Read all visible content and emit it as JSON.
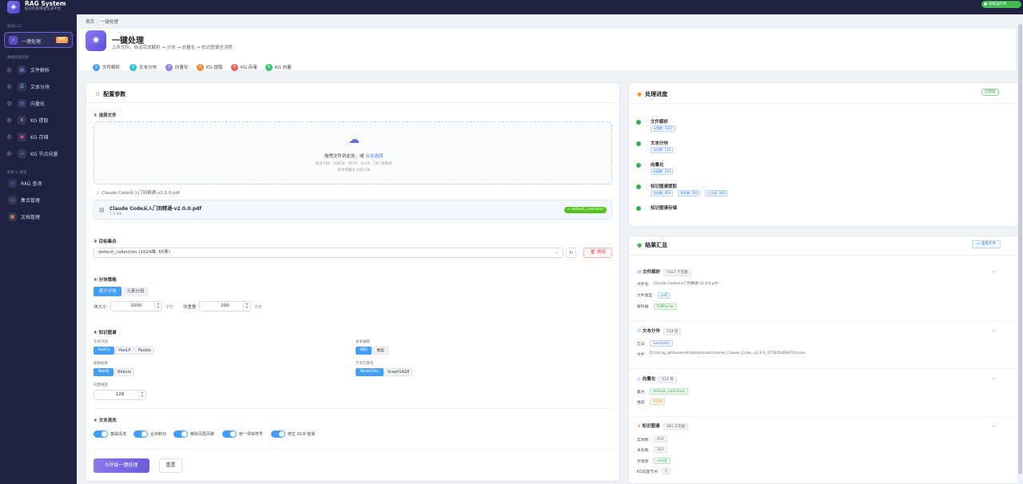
{
  "app": {
    "title": "RAG System",
    "subtitle": "知识检索增强生成平台",
    "status": "系统运行中"
  },
  "sidebar": {
    "section_quick": "快速入口",
    "active_item": {
      "label": "一键处理",
      "badge": "推荐",
      "icon": "bolt-icon"
    },
    "section_pipeline": "数据处理流程",
    "pipeline_items": [
      {
        "num": "1",
        "label": "文件解析",
        "icon": "file-icon"
      },
      {
        "num": "2",
        "label": "文本分块",
        "icon": "chunk-icon"
      },
      {
        "num": "3",
        "label": "向量化",
        "icon": "vector-icon"
      },
      {
        "num": "4",
        "label": "KG 提取",
        "icon": "graph-icon"
      },
      {
        "num": "5",
        "label": "KG 存储",
        "icon": "database-icon"
      },
      {
        "num": "6",
        "label": "KG 节点向量",
        "icon": "node-icon"
      }
    ],
    "section_search": "检索 & 管理",
    "manage_items": [
      {
        "label": "RAG 查询",
        "icon": "search-icon"
      },
      {
        "label": "集合管理",
        "icon": "folder-icon"
      },
      {
        "label": "文档管理",
        "icon": "document-icon"
      }
    ]
  },
  "breadcrumb": {
    "home": "首页",
    "sep": "/",
    "current": "一键处理"
  },
  "header": {
    "title": "一键处理",
    "subtitle": "上传文件，自动完成解析 → 分块 → 向量化 → 知识图谱全流程",
    "steps": [
      {
        "num": "1",
        "label": "文件解析",
        "color": "#4aa3f0"
      },
      {
        "num": "2",
        "label": "文本分块",
        "color": "#36c2c9"
      },
      {
        "num": "3",
        "label": "向量化",
        "color": "#9b7be8"
      },
      {
        "num": "4",
        "label": "KG 提取",
        "color": "#f08a3a"
      },
      {
        "num": "5",
        "label": "KG 存储",
        "color": "#f0605a"
      },
      {
        "num": "6",
        "label": "KG 向量",
        "color": "#3ec46d"
      }
    ]
  },
  "config": {
    "title": "配置参数",
    "file_section": "① 选择文件",
    "drop": {
      "text": "拖拽文件到此处，或",
      "link": "点击选择",
      "formats": "支持 PDF · DOCX · PPTX · XLSX · TXT 等格式",
      "max_size": "单文件最大 100 GB"
    },
    "selected_file_line": "Claude Code从入门到精通-v2.0.0.pdf",
    "file": {
      "name": "Claude Code从入门到精通-v2.0.0.pdf",
      "size": "7.6 MB",
      "target": "→ default_collection"
    },
    "collection_section": "② 目标集合",
    "collection_value": "default_collection (1024维, 65条)",
    "delete_label": "删除",
    "chunk_section": "③ 分块策略",
    "chunk_modes": [
      "语义分块",
      "元素分组"
    ],
    "chunk_size_label": "块大小",
    "chunk_size": "1000",
    "chunk_size_unit": "字符",
    "overlap_label": "块重叠",
    "overlap": "200",
    "overlap_unit": "字符",
    "kg_section": "④ 知识图谱",
    "entity_label": "实体识别",
    "entity_options": [
      "SpaCy",
      "HanLP",
      "Paddle"
    ],
    "relation_label": "关系抽取",
    "relation_options": [
      "规则",
      "模型"
    ],
    "graphdb_label": "图数据库",
    "graphdb_options": [
      "Neo4j",
      "Nebula"
    ],
    "node_vec_label": "节点向量化",
    "node_vec_options": [
      "Node2Vec",
      "GraphSAGE"
    ],
    "vec_dim_label": "向量维度",
    "vec_dim": "128",
    "clean_section": "⑤ 文本清洗",
    "clean_options": [
      "基础清洗",
      "合并断句",
      "移除页眉页脚",
      "统一项目符号",
      "修正 OCR 错误"
    ],
    "start_label": "开始一键处理",
    "reset_label": "重置"
  },
  "progress": {
    "title": "处理进度",
    "status": "已完成",
    "items": [
      {
        "name": "文件解析",
        "tags": [
          "元素数: 1027"
        ]
      },
      {
        "name": "文本分块",
        "tags": [
          "分块数: 114"
        ]
      },
      {
        "name": "向量化",
        "tags": [
          "向量数: 114"
        ]
      },
      {
        "name": "知识图谱提取",
        "tags": [
          "实体数: 954",
          "关系数: 283",
          "三元组: 283"
        ]
      },
      {
        "name": "知识图谱存储",
        "tags": []
      }
    ]
  },
  "results": {
    "title": "结果汇总",
    "view_files": "查看文件",
    "parse": {
      "title": "文件解析",
      "count": "1027 个元素",
      "file_key": "文件名",
      "file_val": "Claude Code从入门到精通-v2.0.0.pdf",
      "type_key": "文件类型",
      "type_val": "pdf",
      "parser_key": "解析器",
      "parser_val": "PdfParser"
    },
    "chunk": {
      "title": "文本分块",
      "count": "114 块",
      "method_key": "方法",
      "method_val": "semantic",
      "file_key": "文件",
      "file_val": "D:\\rz\\rag_git\\backend\\data\\chunks\\chunks_Claude_Code_-v2.0.0_1776414664763.json"
    },
    "vector": {
      "title": "向量化",
      "count": "114 条",
      "coll_key": "集合",
      "coll_val": "default_collection",
      "dim_key": "维度",
      "dim_val": "1024"
    },
    "kg": {
      "title": "知识图谱",
      "count": "283 三元组",
      "entity_key": "实体数",
      "entity_val": "954",
      "relation_key": "关系数",
      "relation_val": "283",
      "store_key": "存储库",
      "store_val": "neo4j",
      "node_key": "KG向量节点",
      "node_val": "0"
    }
  }
}
